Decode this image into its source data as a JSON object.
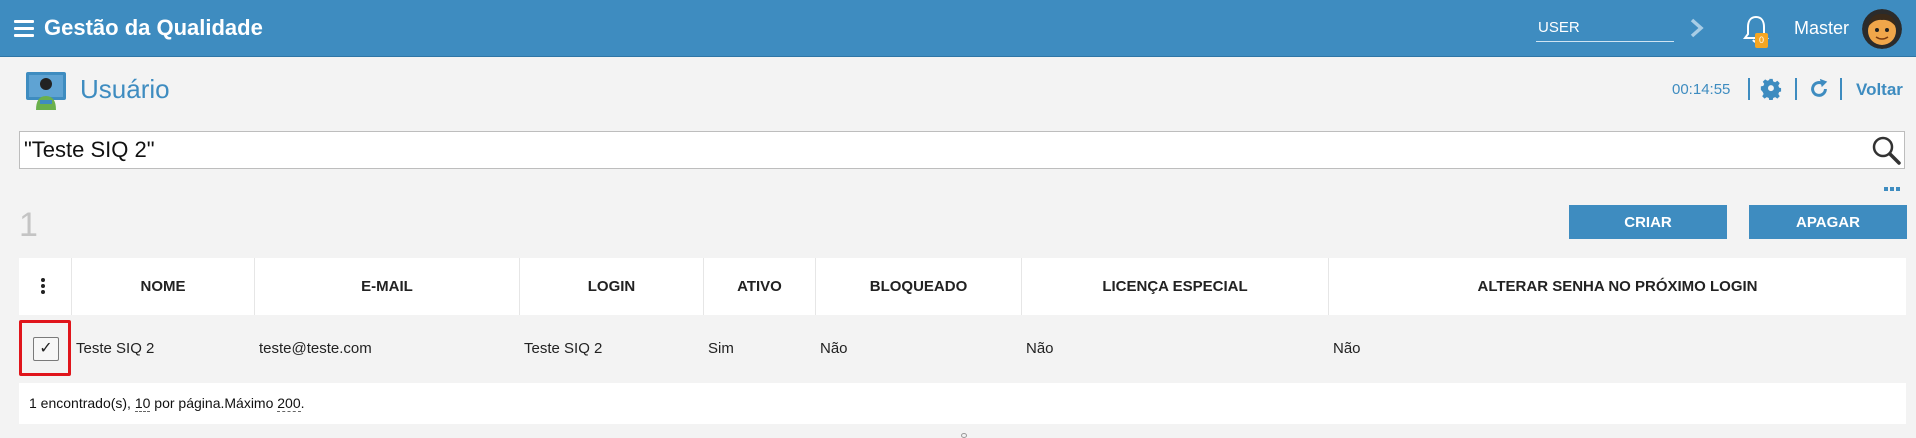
{
  "header": {
    "app_title": "Gestão da Qualidade",
    "user_field_placeholder": "USER",
    "notification_count": "0",
    "user_name": "Master",
    "menu_icon": "hamburger-menu-icon",
    "bar_color": "#3e8cc0"
  },
  "page": {
    "title": "Usuário",
    "timer": "00:14:55",
    "back_label": "Voltar",
    "title_color": "#3e8cc0"
  },
  "search": {
    "value": "\"Teste SIQ 2\""
  },
  "results": {
    "count": "1",
    "create_label": "CRIAR",
    "delete_label": "APAGAR"
  },
  "table": {
    "columns": [
      "NOME",
      "E-MAIL",
      "LOGIN",
      "ATIVO",
      "BLOQUEADO",
      "LICENÇA ESPECIAL",
      "ALTERAR SENHA NO PRÓXIMO LOGIN"
    ],
    "rows": [
      {
        "checked": "✓",
        "nome": "Teste SIQ 2",
        "email": "teste@teste.com",
        "login": "Teste SIQ 2",
        "ativo": "Sim",
        "bloqueado": "Não",
        "licenca_especial": "Não",
        "alterar_senha": "Não"
      }
    ],
    "footer": {
      "found_text": "1 encontrado(s), ",
      "per_page_value": "10",
      "per_page_text": " por página.Máximo ",
      "max_value": "200",
      "end_text": "."
    }
  }
}
